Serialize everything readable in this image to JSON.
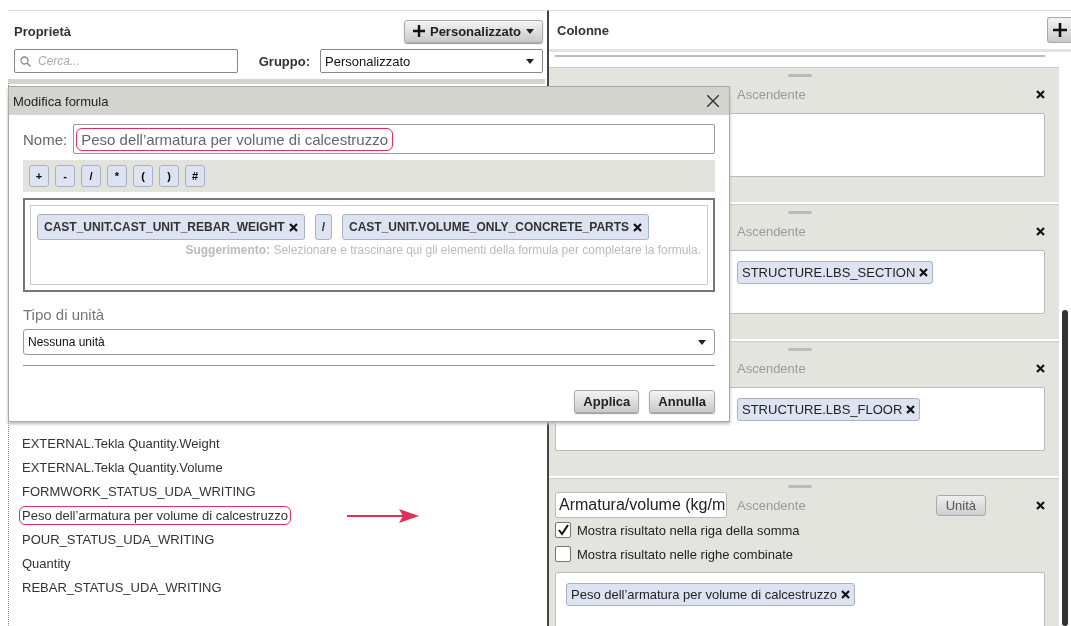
{
  "properties_panel": {
    "title": "Proprietà",
    "add_button": "Personalizzato",
    "search": {
      "placeholder": "Cerca..."
    },
    "group_label": "Gruppo:",
    "group_value": "Personalizzato",
    "items": [
      {
        "label": "EXTERNAL.Tekla Quantity.Weight",
        "highlighted": false
      },
      {
        "label": "EXTERNAL.Tekla Quantity.Volume",
        "highlighted": false
      },
      {
        "label": "FORMWORK_STATUS_UDA_WRITING",
        "highlighted": false
      },
      {
        "label": "Peso dell’armatura per volume di calcestruzzo",
        "highlighted": true
      },
      {
        "label": "POUR_STATUS_UDA_WRITING",
        "highlighted": false
      },
      {
        "label": "Quantity",
        "highlighted": false
      },
      {
        "label": "REBAR_STATUS_UDA_WRITING",
        "highlighted": false
      }
    ]
  },
  "columns_panel": {
    "title": "Colonne",
    "columns": [
      {
        "kind": "box_only"
      },
      {
        "kind": "column",
        "sort": "Ascendente"
      },
      {
        "kind": "column",
        "sort": "Ascendente",
        "tokens": [
          "STRUCTURE.LBS_SECTION"
        ]
      },
      {
        "kind": "column",
        "sort": "Ascendente",
        "tokens": [
          "STRUCTURE.LBS_FLOOR"
        ]
      },
      {
        "kind": "column",
        "name": "Armatura/volume (kg/m",
        "sort": "Ascendente",
        "unit_button": "Unità",
        "options": [
          {
            "label": "Mostra risultato nella riga della somma",
            "checked": true
          },
          {
            "label": "Mostra risultato nelle righe combinate",
            "checked": false
          }
        ],
        "tokens": [
          "Peso dell’armatura per volume di calcestruzzo"
        ]
      }
    ]
  },
  "dialog": {
    "title": "Modifica formula",
    "name_label": "Nome:",
    "name_value": "Peso dell’armatura per volume di calcestruzzo",
    "name_highlighted": true,
    "operators": [
      "+",
      "-",
      "/",
      "*",
      "(",
      ")",
      "#"
    ],
    "formula": [
      {
        "kind": "field",
        "text": "CAST_UNIT.CAST_UNIT_REBAR_WEIGHT"
      },
      {
        "kind": "operator",
        "text": "/"
      },
      {
        "kind": "field",
        "text": "CAST_UNIT.VOLUME_ONLY_CONCRETE_PARTS"
      }
    ],
    "hint": "**Suggerimento:** Selezionare e trascinare qui gli elementi della formula per completare la formula.",
    "unit_label": "Tipo di unità",
    "unit_value": "Nessuna unità",
    "buttons": [
      "Applica",
      "Annulla"
    ]
  }
}
